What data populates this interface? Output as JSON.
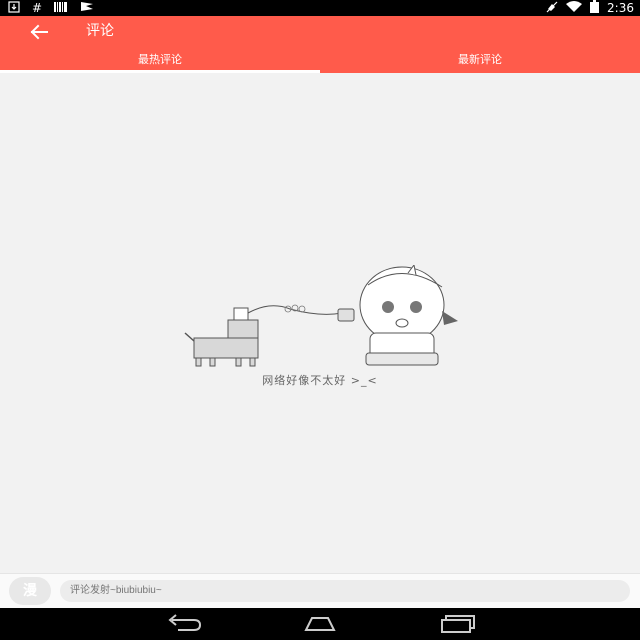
{
  "status_bar": {
    "time": "2:36",
    "left_icons": [
      "download-icon",
      "hash-icon",
      "barcode-icon",
      "flag-icon"
    ],
    "right_icons": [
      "mute-icon",
      "wifi-icon",
      "battery-icon"
    ]
  },
  "header": {
    "title": "评论",
    "back_icon": "arrow-left-icon"
  },
  "tabs": [
    {
      "label": "最热评论",
      "active": true
    },
    {
      "label": "最新评论",
      "active": false
    }
  ],
  "empty_state": {
    "message": "网络好像不太好 >_<"
  },
  "comment_bar": {
    "avatar_text": "漫",
    "placeholder": "评论发射~biubiubiu~"
  },
  "nav_bar": {
    "icons": [
      "back-icon",
      "home-icon",
      "recents-icon"
    ]
  },
  "colors": {
    "accent": "#ff5b4b",
    "background": "#f2f2f2"
  }
}
